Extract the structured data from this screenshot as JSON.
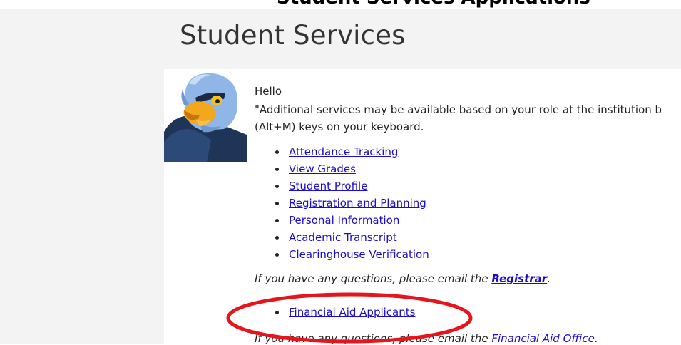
{
  "top_strip": {
    "text": "Student Services Applications"
  },
  "page": {
    "title": "Student Services"
  },
  "welcome": {
    "greeting": "Hello",
    "info_line_1": "\"Additional services may be available based on your role at the institution b",
    "info_line_2": "(Alt+M) keys on your keyboard."
  },
  "services": [
    {
      "label": "Attendance Tracking"
    },
    {
      "label": "View Grades"
    },
    {
      "label": "Student Profile"
    },
    {
      "label": "Registration and Planning"
    },
    {
      "label": "Personal Information"
    },
    {
      "label": "Academic Transcript"
    },
    {
      "label": "Clearinghouse Verification"
    }
  ],
  "registrar_note": {
    "prefix": "If you have any questions, please email the ",
    "link": "Registrar",
    "suffix": "."
  },
  "aid": {
    "label": "Financial Aid Applicants"
  },
  "aid_note": {
    "prefix": "If you have any questions, please email the ",
    "link": "Financial Aid Office",
    "suffix": "."
  },
  "colors": {
    "link": "#1a0dcc",
    "highlight": "#e8141b",
    "background": "#f3f3f3"
  },
  "icons": {
    "avatar": "eagle-mascot-icon"
  }
}
